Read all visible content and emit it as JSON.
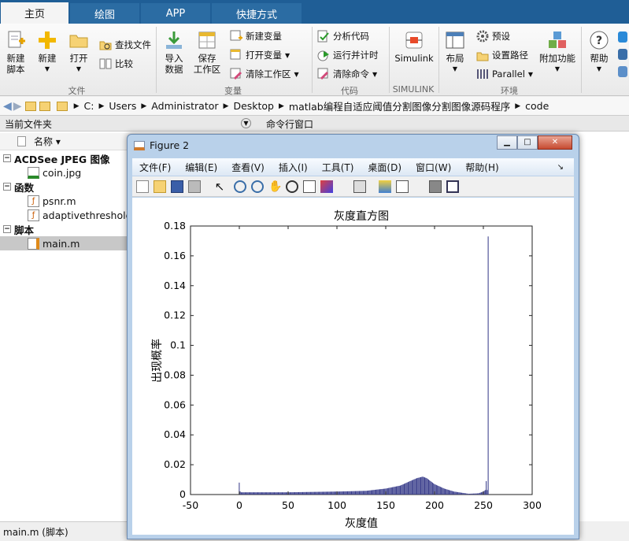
{
  "tabs": [
    {
      "label": "主页",
      "active": true
    },
    {
      "label": "绘图",
      "active": false
    },
    {
      "label": "APP",
      "active": false
    },
    {
      "label": "快捷方式",
      "active": false
    }
  ],
  "ribbon": {
    "new_script": "新建\n脚本",
    "new": "新建",
    "open": "打开",
    "find_files": "查找文件",
    "compare": "比较",
    "import_data": "导入\n数据",
    "save_workspace": "保存\n工作区",
    "new_variable": "新建变量",
    "open_variable": "打开变量",
    "clear_workspace": "清除工作区",
    "analyze_code": "分析代码",
    "run_and_time": "运行并计时",
    "clear_commands": "清除命令",
    "simulink": "Simulink",
    "layout": "布局",
    "preferences": "预设",
    "set_path": "设置路径",
    "parallel": "Parallel",
    "addons": "附加功能",
    "help": "帮助",
    "groups": {
      "file": "文件",
      "variable": "变量",
      "code": "代码",
      "simulink": "SIMULINK",
      "environment": "环境"
    }
  },
  "address": {
    "crumbs": [
      "C:",
      "Users",
      "Administrator",
      "Desktop",
      "matlab编程自适应阈值分割图像分割图像源码程序",
      "code"
    ]
  },
  "current_folder": {
    "header": "当前文件夹",
    "name_col": "名称 ▾",
    "groups": [
      {
        "label": "ACDSee JPEG 图像",
        "files": [
          "coin.jpg"
        ]
      },
      {
        "label": "函数",
        "files": [
          "psnr.m",
          "adaptivethreshold"
        ]
      },
      {
        "label": "脚本",
        "files": [
          "main.m"
        ]
      }
    ]
  },
  "command_window": {
    "header": "命令行窗口"
  },
  "status": {
    "text": "main.m  (脚本)"
  },
  "figure": {
    "title": "Figure 2",
    "menu": [
      "文件(F)",
      "编辑(E)",
      "查看(V)",
      "插入(I)",
      "工具(T)",
      "桌面(D)",
      "窗口(W)",
      "帮助(H)"
    ]
  },
  "colors": {
    "accent": "#1f5e96",
    "bar": "#3b3f8c"
  },
  "chart_data": {
    "type": "bar",
    "title": "灰度直方图",
    "xlabel": "灰度值",
    "ylabel": "出现概率",
    "xlim": [
      -50,
      300
    ],
    "ylim": [
      0,
      0.18
    ],
    "xticks": [
      -50,
      0,
      50,
      100,
      150,
      200,
      250,
      300
    ],
    "yticks": [
      0,
      0.02,
      0.04,
      0.06,
      0.08,
      0.1,
      0.12,
      0.14,
      0.16,
      0.18
    ],
    "anchors_x": [
      0,
      1,
      2,
      10,
      50,
      100,
      130,
      150,
      165,
      175,
      182,
      188,
      192,
      200,
      210,
      220,
      235,
      245,
      250,
      252,
      253,
      254,
      255
    ],
    "anchors_y": [
      0.008,
      0.002,
      0.0015,
      0.0015,
      0.0015,
      0.002,
      0.0025,
      0.004,
      0.006,
      0.009,
      0.011,
      0.012,
      0.011,
      0.007,
      0.004,
      0.002,
      0.0005,
      0.0008,
      0.002,
      0.003,
      0.009,
      0.003,
      0.173
    ]
  }
}
